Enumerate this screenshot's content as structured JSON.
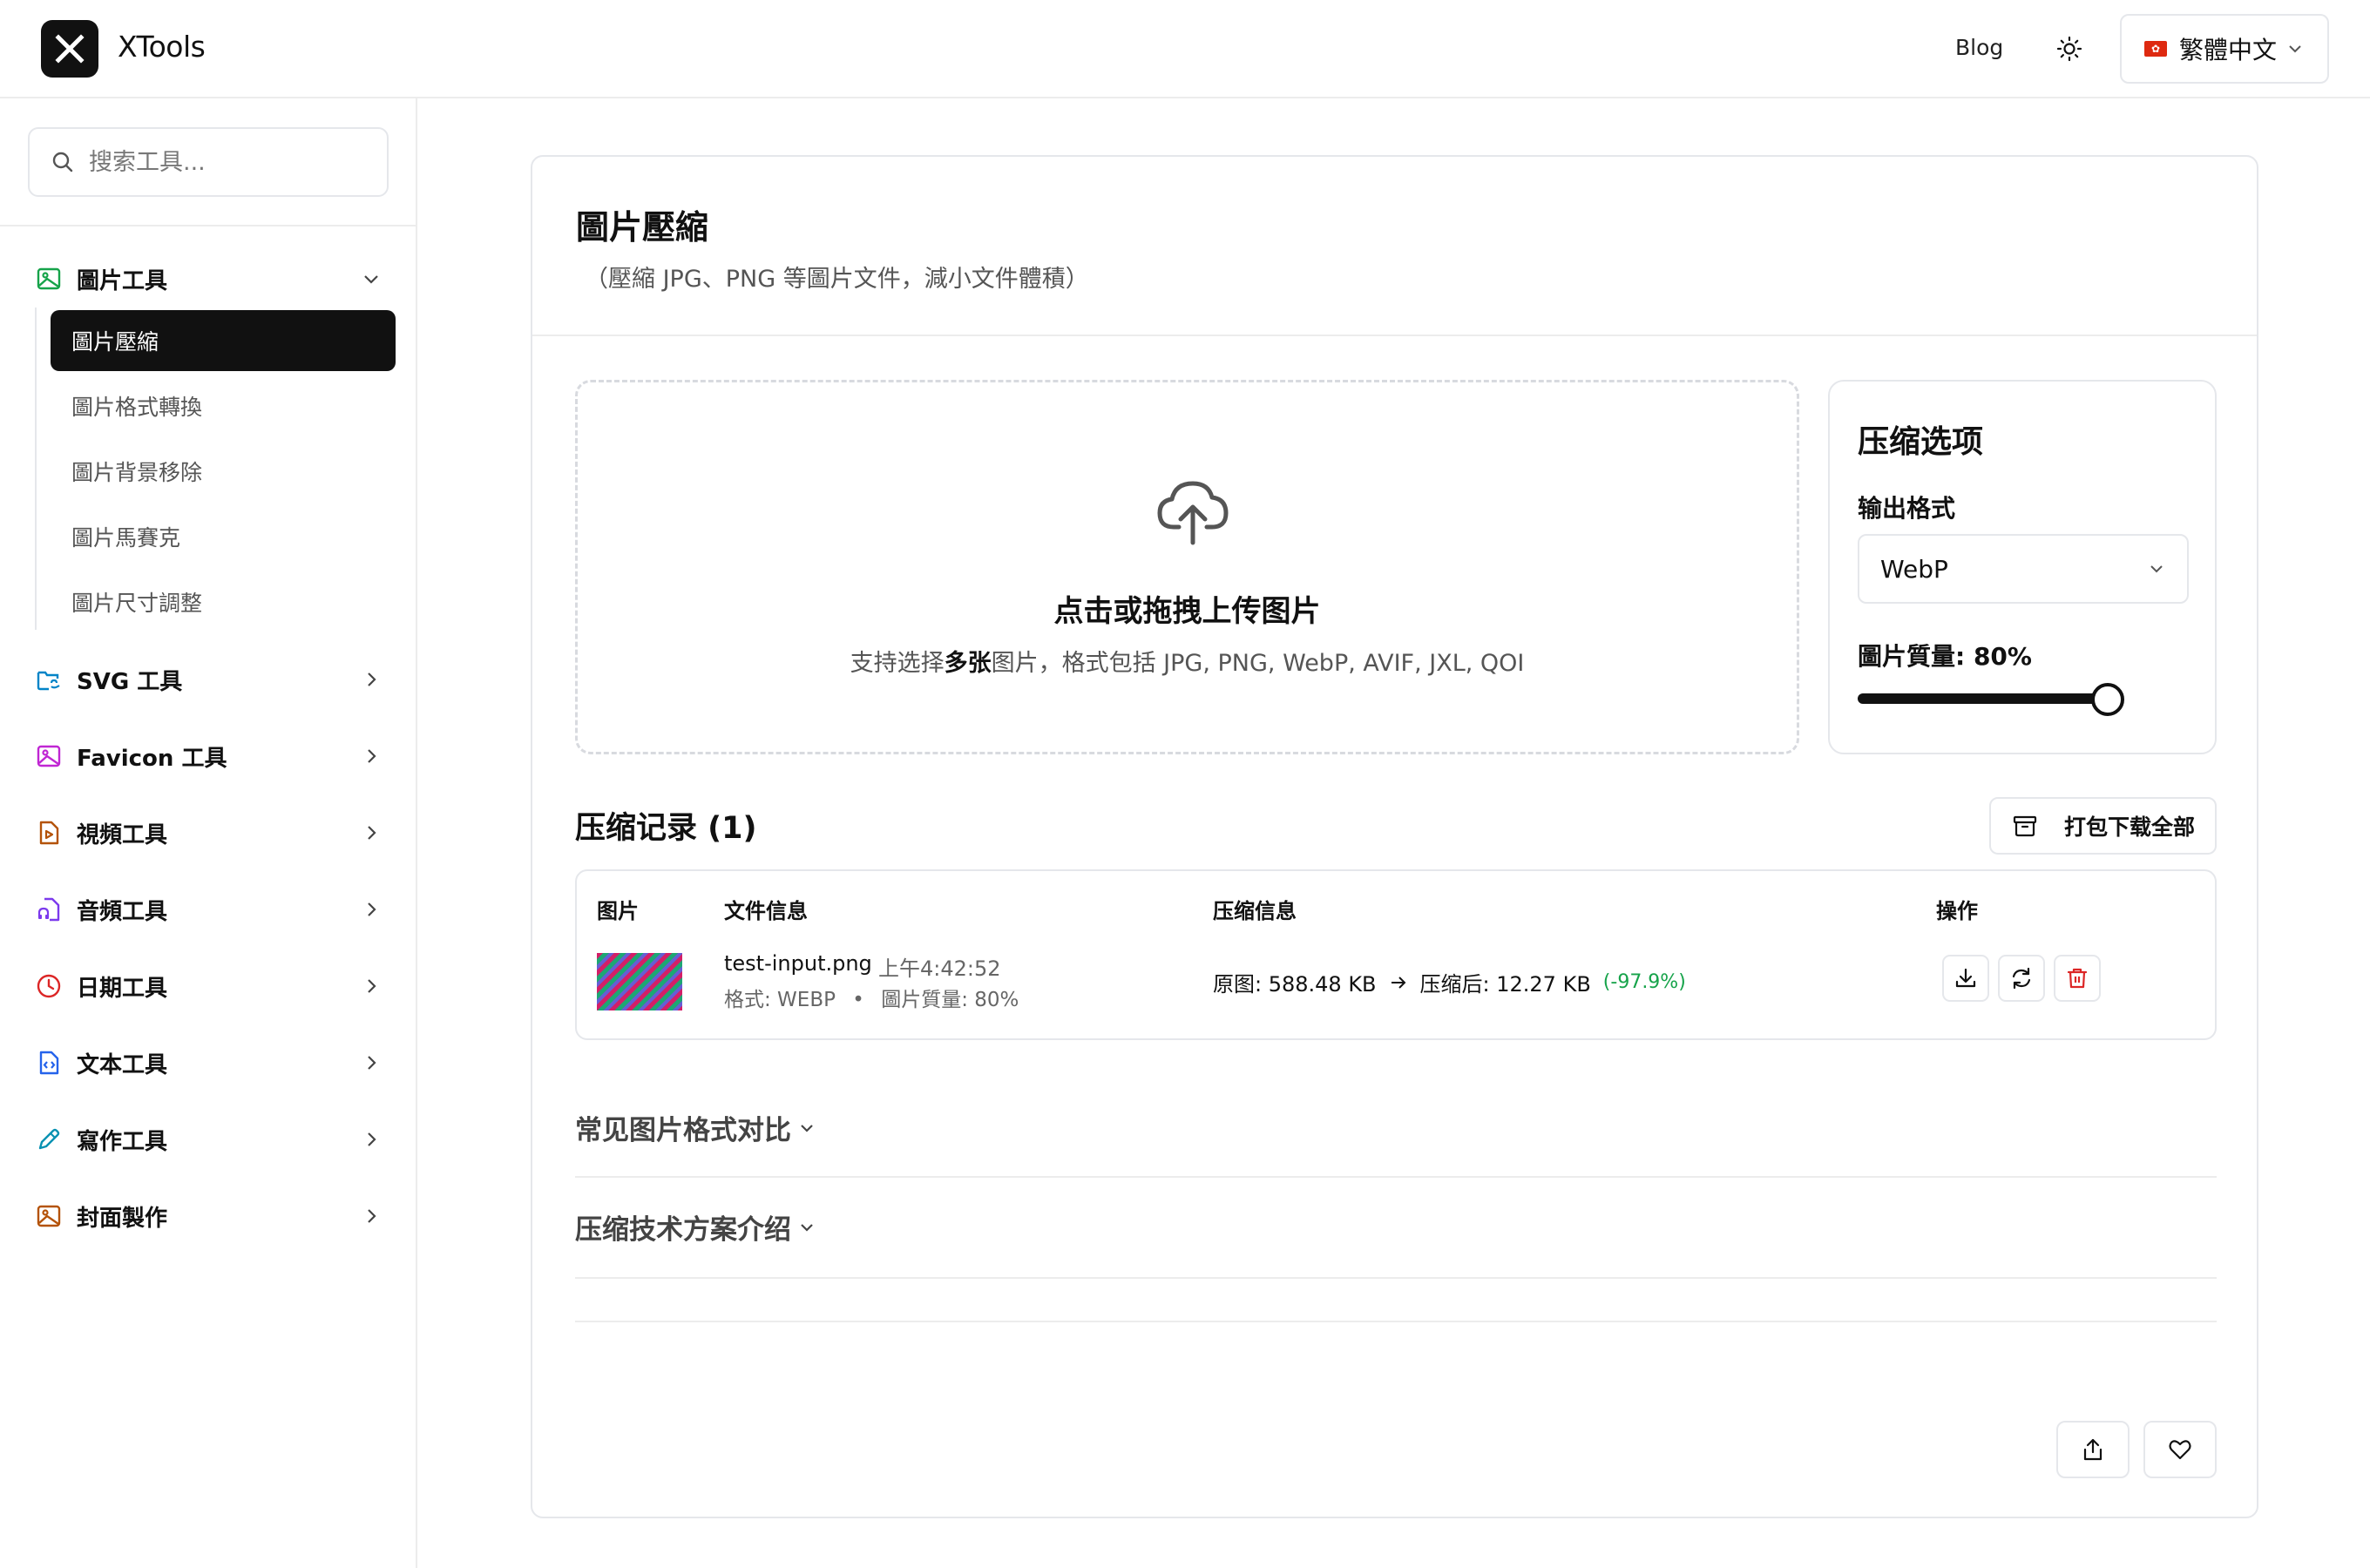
{
  "app": {
    "name": "XTools",
    "blog_label": "Blog",
    "language_label": "繁體中文"
  },
  "search": {
    "placeholder": "搜索工具..."
  },
  "sidebar": {
    "categories": [
      {
        "label": "圖片工具",
        "icon": "image-icon",
        "color": "#16a34a",
        "expanded": true
      },
      {
        "label": "SVG 工具",
        "icon": "svg-folder-icon",
        "color": "#0284c7",
        "expanded": false
      },
      {
        "label": "Favicon 工具",
        "icon": "favicon-image-icon",
        "color": "#c026d3",
        "expanded": false
      },
      {
        "label": "視頻工具",
        "icon": "video-file-icon",
        "color": "#b45309",
        "expanded": false
      },
      {
        "label": "音頻工具",
        "icon": "audio-file-icon",
        "color": "#7c3aed",
        "expanded": false
      },
      {
        "label": "日期工具",
        "icon": "clock-icon",
        "color": "#dc2626",
        "expanded": false
      },
      {
        "label": "文本工具",
        "icon": "code-file-icon",
        "color": "#2563eb",
        "expanded": false
      },
      {
        "label": "寫作工具",
        "icon": "pencil-icon",
        "color": "#0891b2",
        "expanded": false
      },
      {
        "label": "封面製作",
        "icon": "cover-image-icon",
        "color": "#b45309",
        "expanded": false
      }
    ],
    "image_tools": [
      {
        "label": "圖片壓縮",
        "active": true
      },
      {
        "label": "圖片格式轉換",
        "active": false
      },
      {
        "label": "圖片背景移除",
        "active": false
      },
      {
        "label": "圖片馬賽克",
        "active": false
      },
      {
        "label": "圖片尺寸調整",
        "active": false
      }
    ]
  },
  "page": {
    "title": "圖片壓縮",
    "subtitle": "（壓縮 JPG、PNG 等圖片文件，減小文件體積）"
  },
  "upload": {
    "title": "点击或拖拽上传图片",
    "hint_prefix": "支持选择",
    "hint_bold": "多张",
    "hint_suffix": "图片，格式包括 JPG, PNG, WebP, AVIF, JXL, QOI"
  },
  "options": {
    "title": "压缩选项",
    "format_label": "输出格式",
    "format_value": "WebP",
    "quality_label": "圖片質量: 80%",
    "quality_value": 80
  },
  "records": {
    "title": "压缩记录 (1)",
    "zip_label": "打包下载全部",
    "columns": [
      "图片",
      "文件信息",
      "压缩信息",
      "操作"
    ],
    "rows": [
      {
        "file_name": "test-input.png",
        "time": "上午4:42:52",
        "format_text": "格式: WEBP",
        "separator": "•",
        "quality_text": "圖片質量: 80%",
        "original": "原图: 588.48 KB",
        "compressed": "压缩后: 12.27 KB",
        "ratio": "(-97.9%)"
      }
    ]
  },
  "accordions": [
    {
      "label": "常见图片格式对比"
    },
    {
      "label": "压缩技术方案介绍"
    }
  ],
  "colors": {
    "accent": "#111111",
    "success": "#16a34a",
    "danger": "#dc2626",
    "border": "#e5e7eb"
  }
}
